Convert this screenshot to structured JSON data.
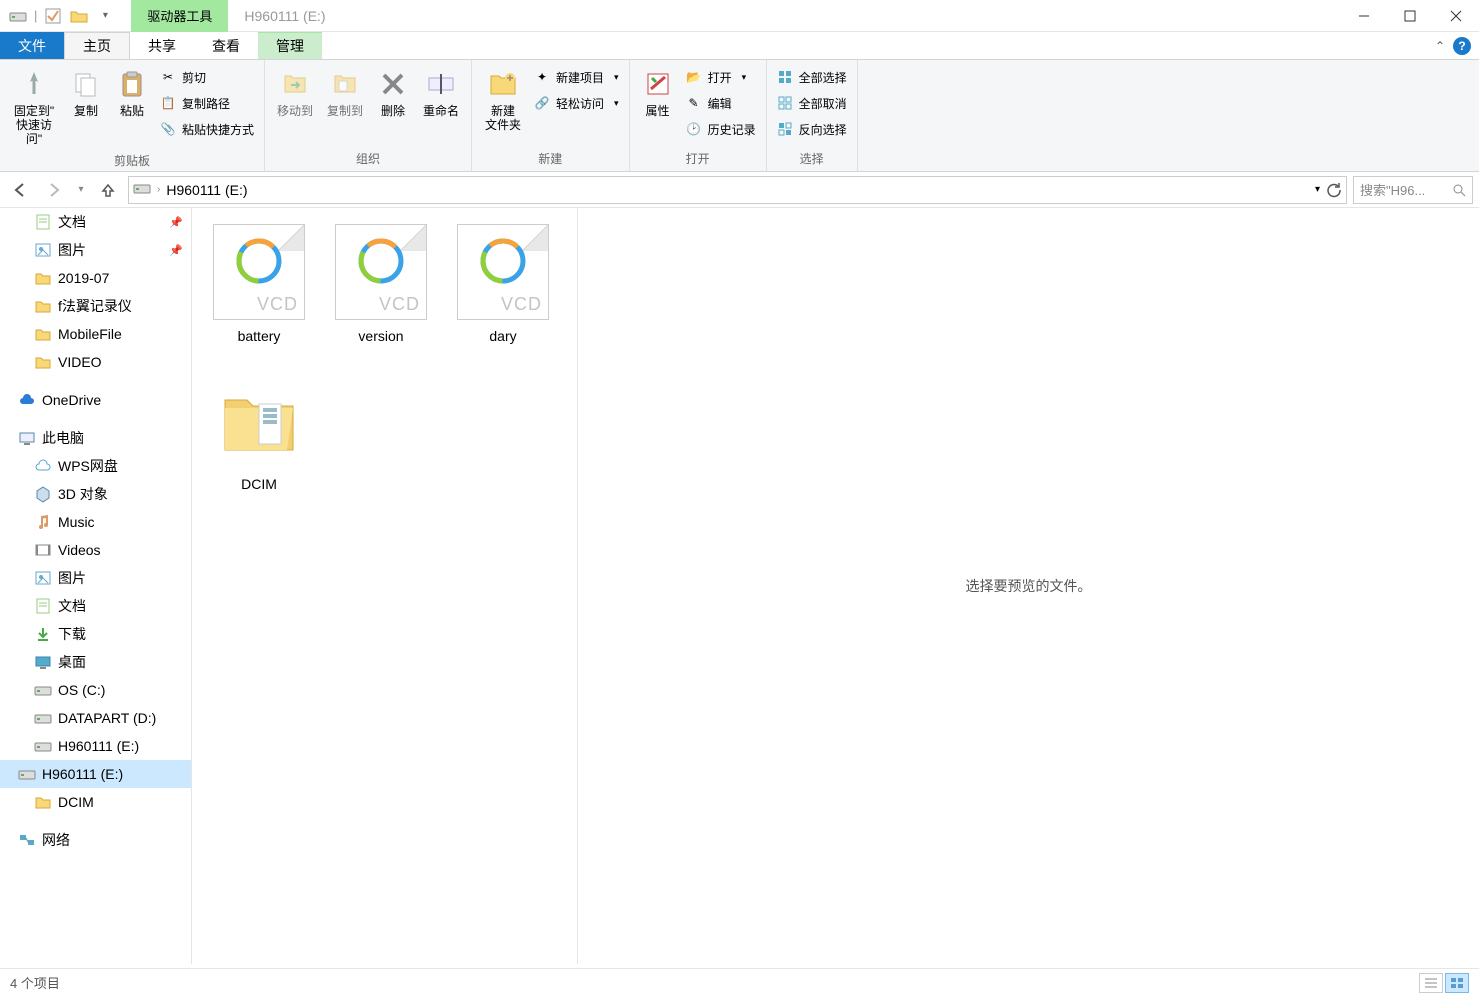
{
  "title": "H960111 (E:)",
  "contextTab": "驱动器工具",
  "tabs": {
    "file": "文件",
    "home": "主页",
    "share": "共享",
    "view": "查看",
    "manage": "管理"
  },
  "ribbon": {
    "clipboard": {
      "title": "剪贴板",
      "pin": "固定到\"\n快速访问\"",
      "copy": "复制",
      "paste": "粘贴",
      "cut": "剪切",
      "copypath": "复制路径",
      "pasteshortcut": "粘贴快捷方式"
    },
    "organize": {
      "title": "组织",
      "moveto": "移动到",
      "copyto": "复制到",
      "delete": "删除",
      "rename": "重命名"
    },
    "new": {
      "title": "新建",
      "newfolder": "新建\n文件夹",
      "newitem": "新建项目",
      "easyaccess": "轻松访问"
    },
    "open": {
      "title": "打开",
      "properties": "属性",
      "open": "打开",
      "edit": "编辑",
      "history": "历史记录"
    },
    "select": {
      "title": "选择",
      "selectall": "全部选择",
      "selectnone": "全部取消",
      "invert": "反向选择"
    }
  },
  "breadcrumb": "H960111 (E:)",
  "search_placeholder": "搜索\"H96...",
  "nav": {
    "quick": [
      {
        "label": "文档",
        "pinned": true,
        "icon": "doc"
      },
      {
        "label": "图片",
        "pinned": true,
        "icon": "pic"
      },
      {
        "label": "2019-07",
        "icon": "folder"
      },
      {
        "label": "f法翼记录仪",
        "icon": "folder"
      },
      {
        "label": "MobileFile",
        "icon": "folder"
      },
      {
        "label": "VIDEO",
        "icon": "folder"
      }
    ],
    "onedrive": "OneDrive",
    "thispc": "此电脑",
    "pcitems": [
      {
        "label": "WPS网盘",
        "icon": "cloud"
      },
      {
        "label": "3D 对象",
        "icon": "3d"
      },
      {
        "label": "Music",
        "icon": "music"
      },
      {
        "label": "Videos",
        "icon": "video"
      },
      {
        "label": "图片",
        "icon": "pic"
      },
      {
        "label": "文档",
        "icon": "doc"
      },
      {
        "label": "下载",
        "icon": "download"
      },
      {
        "label": "桌面",
        "icon": "desktop"
      },
      {
        "label": "OS (C:)",
        "icon": "drive"
      },
      {
        "label": "DATAPART (D:)",
        "icon": "drive"
      },
      {
        "label": "H960111 (E:)",
        "icon": "drive"
      }
    ],
    "selected": "H960111 (E:)",
    "dcim": "DCIM",
    "network": "网络"
  },
  "files": [
    {
      "name": "battery",
      "type": "vcd"
    },
    {
      "name": "version",
      "type": "vcd"
    },
    {
      "name": "dary",
      "type": "vcd"
    },
    {
      "name": "DCIM",
      "type": "folder"
    }
  ],
  "preview_msg": "选择要预览的文件。",
  "status": "4 个项目"
}
